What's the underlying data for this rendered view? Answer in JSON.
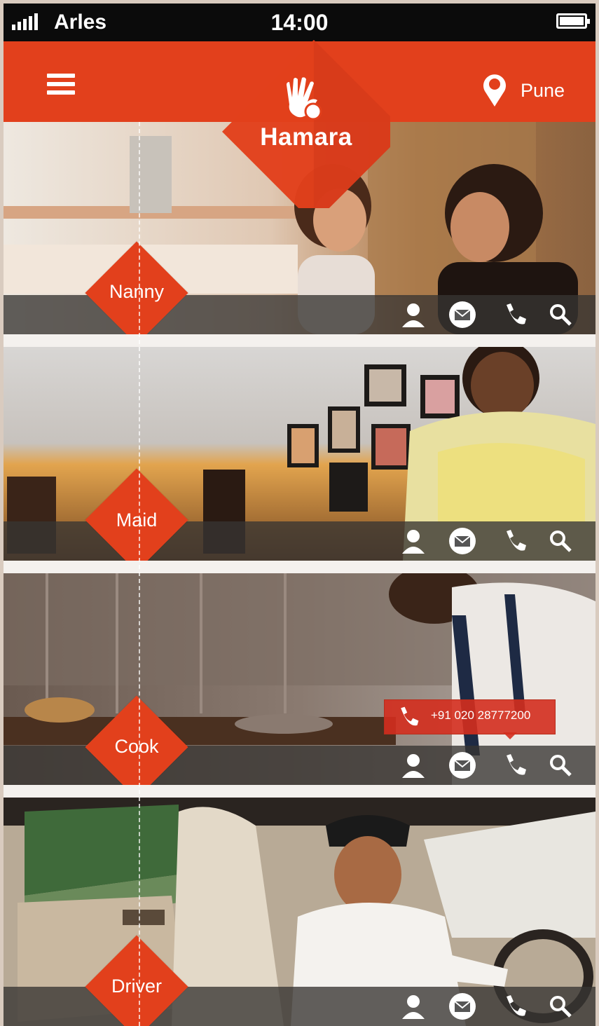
{
  "status_bar": {
    "carrier": "Arles",
    "time": "14:00"
  },
  "header": {
    "brand": "Hamara",
    "city": "Pune"
  },
  "categories": [
    {
      "label": "Nanny"
    },
    {
      "label": "Maid"
    },
    {
      "label": "Cook"
    },
    {
      "label": "Driver"
    }
  ],
  "call_tag": {
    "number": "+91 020 28777200"
  },
  "colors": {
    "accent": "#e2401c",
    "status_bar": "#0b0b0b",
    "action_bar": "#373432"
  },
  "icons": [
    "menu-icon",
    "hand-logo-icon",
    "location-pin-icon",
    "profile-icon",
    "mail-icon",
    "phone-icon",
    "search-icon"
  ]
}
